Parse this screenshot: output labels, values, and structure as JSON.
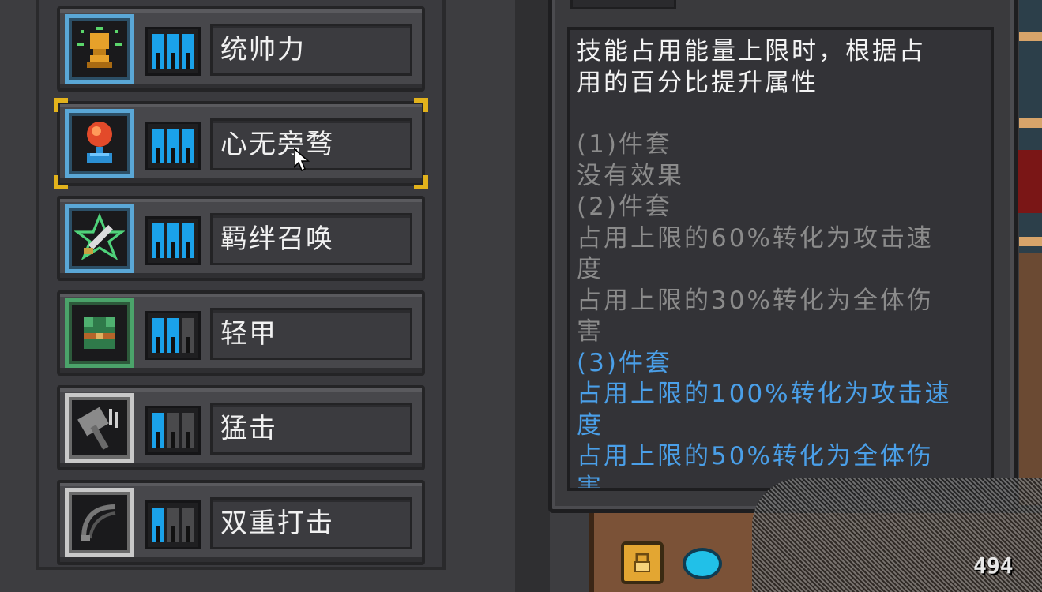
{
  "skills": [
    {
      "name": "统帅力",
      "icon": "trophy-icon",
      "frame": "blue",
      "level": 3,
      "max_level": 3
    },
    {
      "name": "心无旁骛",
      "icon": "red-orb-icon",
      "frame": "blue",
      "level": 3,
      "max_level": 3
    },
    {
      "name": "羁绊召唤",
      "icon": "star-sword-icon",
      "frame": "blue",
      "level": 3,
      "max_level": 3
    },
    {
      "name": "轻甲",
      "icon": "light-armor-icon",
      "frame": "green",
      "level": 2,
      "max_level": 3
    },
    {
      "name": "猛击",
      "icon": "hammer-icon",
      "frame": "grey",
      "level": 1,
      "max_level": 3
    },
    {
      "name": "双重打击",
      "icon": "double-strike-icon",
      "frame": "grey",
      "level": 1,
      "max_level": 3
    }
  ],
  "selected_skill_index": 1,
  "tooltip": {
    "description_lines": [
      "技能占用能量上限时，根据占",
      "用的百分比提升属性"
    ],
    "tier1_title": "(1)件套",
    "tier1_lines": [
      "没有效果"
    ],
    "tier2_title": "(2)件套",
    "tier2_lines": [
      "占用上限的60%转化为攻击速",
      "度",
      "占用上限的30%转化为全体伤",
      "害"
    ],
    "tier3_title": "(3)件套",
    "tier3_lines": [
      "占用上限的100%转化为攻击速",
      "度",
      "占用上限的50%转化为全体伤",
      "害"
    ]
  },
  "bottom_bar": {
    "lock_icon": "lock-icon",
    "gem_icon": "gem-icon",
    "coin_count": "494"
  },
  "colors": {
    "active_pip": "#1aa2ea",
    "inactive_pip": "#4a4a4c",
    "selected_corner": "#e2b21c",
    "tier_grey": "#8b8b8b",
    "tier_blue": "#4a9fe8"
  }
}
